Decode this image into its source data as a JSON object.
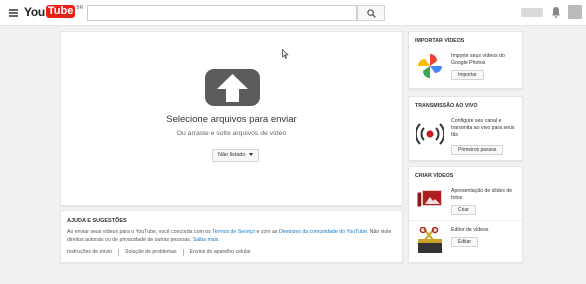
{
  "header": {
    "logo_you": "You",
    "logo_tube": "Tube",
    "logo_country": "BR",
    "search_placeholder": ""
  },
  "upload": {
    "title": "Selecione arquivos para enviar",
    "subtitle": "Ou arraste e solte arquivos de vídeo",
    "privacy_label": "Não listado"
  },
  "help": {
    "title": "AJUDA E SUGESTÕES",
    "text_part1": "Ao enviar seus vídeos para o YouTube, você concorda com os ",
    "terms_link": "Termos de Serviço",
    "text_part2": " e com as ",
    "guidelines_link": "Diretrizes da comunidade do YouTube",
    "text_part3": ". Não viole direitos autorais ou de privacidade de outras pessoas. ",
    "learn_more": "Saiba mais",
    "links": [
      "Instruções de envio",
      "Solução de problemas",
      "Envios do aparelho celular"
    ]
  },
  "import_card": {
    "title": "IMPORTAR VÍDEOS",
    "desc": "Importe seus vídeos do Google Photos",
    "button": "Importar"
  },
  "live_card": {
    "title": "TRANSMISSÃO AO VIVO",
    "desc": "Configure seu canal e transmita ao vivo para seus fãs",
    "button": "Primeiros passos"
  },
  "create_card": {
    "title": "CRIAR VÍDEOS",
    "slideshow_desc": "Apresentação de slides de fotos",
    "slideshow_button": "Criar",
    "editor_desc": "Editor de vídeos",
    "editor_button": "Editar"
  },
  "icons": {
    "menu": "hamburger-menu-icon",
    "search": "search-icon",
    "upload": "upload-arrow-icon",
    "photos": "google-photos-pinwheel-icon",
    "live": "live-broadcast-icon",
    "slideshow": "photo-slideshow-icon",
    "editor": "scissors-clapper-icon"
  },
  "colors": {
    "brand_red": "#e62117",
    "link_blue": "#167ac6"
  }
}
